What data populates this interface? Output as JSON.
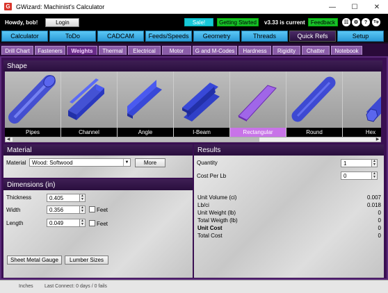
{
  "window": {
    "title": "GWizard: Machinist's Calculator",
    "app_icon": "G"
  },
  "header": {
    "greeting": "Howdy, bob!",
    "login_label": "Login",
    "sale_label": "Sale!",
    "getting_started_label": "Getting Started",
    "version_text": "v3.33 is current",
    "feedback_label": "Feedback",
    "tip_label": "Tip"
  },
  "main_tabs": [
    "Calculator",
    "ToDo",
    "CADCAM",
    "Feeds/Speeds",
    "Geometry",
    "Threads",
    "Quick Refs",
    "Setup"
  ],
  "sub_tabs": [
    "Drill Chart",
    "Fasteners",
    "Weights",
    "Thermal",
    "Electrical",
    "Motor",
    "G and M-Codes",
    "Hardness",
    "Rigidity",
    "Chatter",
    "Notebook"
  ],
  "shape": {
    "title": "Shape",
    "items": [
      "Pipes",
      "Channel",
      "Angle",
      "I-Beam",
      "Rectangular",
      "Round",
      "Hex"
    ],
    "selected": "Rectangular"
  },
  "material": {
    "title": "Material",
    "label": "Material",
    "value": "Wood: Softwood",
    "more_label": "More"
  },
  "dimensions": {
    "title": "Dimensions (in)",
    "thickness_label": "Thickness",
    "thickness_value": "0.405",
    "width_label": "Width",
    "width_value": "0.356",
    "length_label": "Length",
    "length_value": "0.049",
    "feet_label": "Feet",
    "sheet_metal_label": "Sheet Metal Gauge",
    "lumber_label": "Lumber Sizes"
  },
  "results": {
    "title": "Results",
    "quantity_label": "Quantity",
    "quantity_value": "1",
    "cost_label": "Cost Per Lb",
    "cost_value": "0",
    "rows": [
      {
        "k": "Unit Volume (ci)",
        "v": "0.007"
      },
      {
        "k": "Lb/ci",
        "v": "0.018"
      },
      {
        "k": "Unit Weight (lb)",
        "v": "0"
      },
      {
        "k": "Total Weigth (lb)",
        "v": "0"
      },
      {
        "k": "Unit Cost",
        "v": "0"
      },
      {
        "k": "Total Cost",
        "v": "0"
      }
    ]
  },
  "status": {
    "units": "Inches",
    "last_connect": "Last Connect: 0 days / 0 fails"
  }
}
